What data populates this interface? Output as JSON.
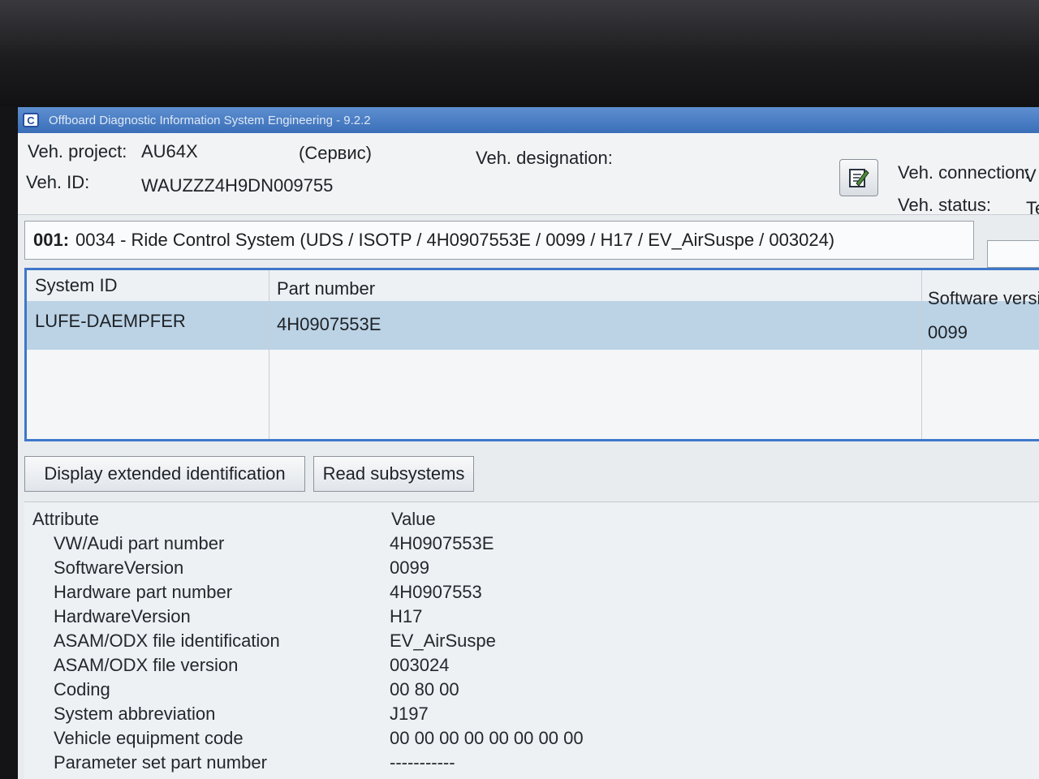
{
  "window": {
    "title": "Offboard Diagnostic Information System Engineering - 9.2.2",
    "icon": "odis-app-icon"
  },
  "header": {
    "veh_project_label": "Veh. project:",
    "veh_project_value": "AU64X",
    "mode": "(Сервис)",
    "veh_designation_label": "Veh. designation:",
    "veh_id_label": "Veh. ID:",
    "veh_id_value": "WAUZZZ4H9DN009755",
    "veh_connection_label": "Veh. connection:",
    "veh_connection_value": "V",
    "veh_status_label": "Veh. status:",
    "veh_status_value": "Te",
    "edit_icon": "edit-notepad-icon"
  },
  "system": {
    "number": "001:",
    "title": "0034 - Ride Control System  (UDS / ISOTP / 4H0907553E / 0099 / H17 / EV_AirSuspe / 003024)"
  },
  "table": {
    "columns": [
      "System ID",
      "Part number",
      "Software versio"
    ],
    "rows": [
      [
        "LUFE-DAEMPFER",
        "4H0907553E",
        "0099"
      ]
    ]
  },
  "buttons": {
    "display_extended": "Display extended identification",
    "read_subsystems": "Read subsystems"
  },
  "attributes": {
    "header_attribute": "Attribute",
    "header_value": "Value",
    "rows": [
      {
        "key": "VW/Audi part number",
        "value": "4H0907553E"
      },
      {
        "key": "SoftwareVersion",
        "value": "0099"
      },
      {
        "key": "Hardware part number",
        "value": "4H0907553"
      },
      {
        "key": "HardwareVersion",
        "value": "H17"
      },
      {
        "key": "ASAM/ODX file identification",
        "value": "EV_AirSuspe"
      },
      {
        "key": "ASAM/ODX file version",
        "value": "003024"
      },
      {
        "key": "Coding",
        "value": "00 80 00"
      },
      {
        "key": "System abbreviation",
        "value": "J197"
      },
      {
        "key": "Vehicle equipment code",
        "value": "00 00 00 00 00 00 00 00"
      },
      {
        "key": "Parameter set part number",
        "value": "-----------"
      }
    ]
  },
  "colors": {
    "titlebar": "#3a6eb8",
    "selection": "#bcd3e6",
    "panel_border": "#3d78c9"
  }
}
